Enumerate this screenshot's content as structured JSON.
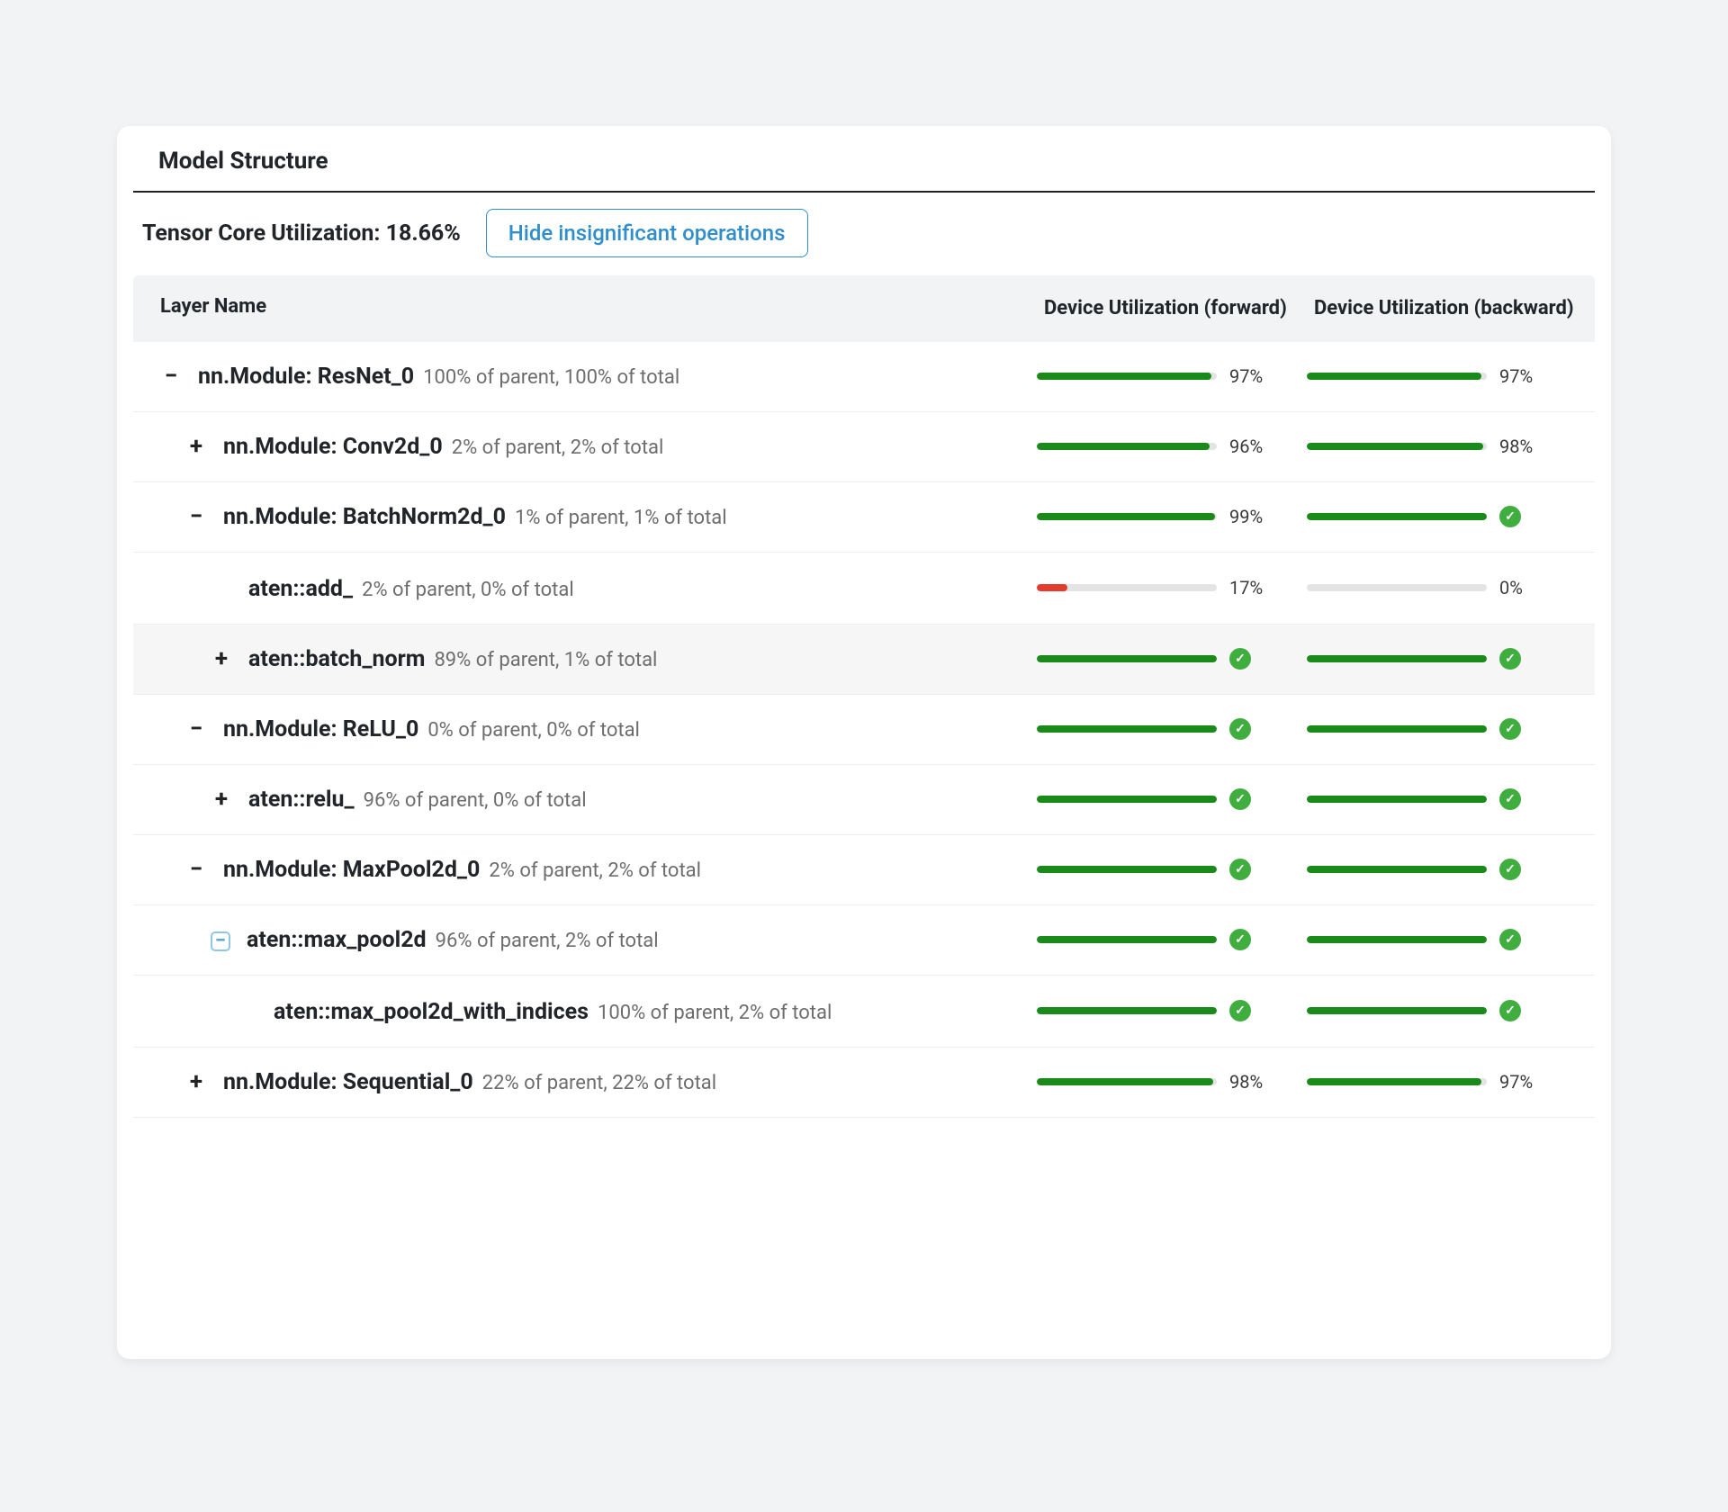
{
  "panel": {
    "title": "Model Structure",
    "tc_util_label": "Tensor Core Utilization: 18.66%",
    "hide_btn": "Hide insignificant operations"
  },
  "headers": {
    "layer": "Layer Name",
    "fwd": "Device Utilization (forward)",
    "bwd": "Device Utilization (backward)"
  },
  "rows": [
    {
      "indent": 0,
      "exp": "minus",
      "name": "nn.Module: ResNet_0",
      "sub": "100% of parent, 100% of total",
      "fwd": {
        "pct": 97,
        "label": "97%"
      },
      "bwd": {
        "pct": 97,
        "label": "97%"
      }
    },
    {
      "indent": 1,
      "exp": "plus",
      "name": "nn.Module: Conv2d_0",
      "sub": "2% of parent, 2% of total",
      "fwd": {
        "pct": 96,
        "label": "96%"
      },
      "bwd": {
        "pct": 98,
        "label": "98%"
      }
    },
    {
      "indent": 1,
      "exp": "minus",
      "name": "nn.Module: BatchNorm2d_0",
      "sub": "1% of parent, 1% of total",
      "fwd": {
        "pct": 99,
        "label": "99%"
      },
      "bwd": {
        "pct": 100,
        "check": true
      }
    },
    {
      "indent": 2,
      "exp": "none",
      "name": "aten::add_",
      "sub": "2% of parent, 0% of total",
      "fwd": {
        "pct": 17,
        "label": "17%",
        "red": true
      },
      "bwd": {
        "pct": 0,
        "label": "0%"
      }
    },
    {
      "indent": 2,
      "exp": "plus",
      "name": "aten::batch_norm",
      "sub": "89% of parent, 1% of total",
      "highlight": true,
      "fwd": {
        "pct": 100,
        "check": true
      },
      "bwd": {
        "pct": 100,
        "check": true
      }
    },
    {
      "indent": 1,
      "exp": "minus",
      "name": "nn.Module: ReLU_0",
      "sub": "0% of parent, 0% of total",
      "fwd": {
        "pct": 100,
        "check": true
      },
      "bwd": {
        "pct": 100,
        "check": true
      }
    },
    {
      "indent": 2,
      "exp": "plus",
      "name": "aten::relu_",
      "sub": "96% of parent, 0% of total",
      "fwd": {
        "pct": 100,
        "check": true
      },
      "bwd": {
        "pct": 100,
        "check": true
      }
    },
    {
      "indent": 1,
      "exp": "minus",
      "name": "nn.Module: MaxPool2d_0",
      "sub": "2% of parent, 2% of total",
      "fwd": {
        "pct": 100,
        "check": true
      },
      "bwd": {
        "pct": 100,
        "check": true
      }
    },
    {
      "indent": 2,
      "exp": "boxed-minus",
      "name": "aten::max_pool2d",
      "sub": "96% of parent, 2% of total",
      "fwd": {
        "pct": 100,
        "check": true
      },
      "bwd": {
        "pct": 100,
        "check": true
      }
    },
    {
      "indent": 3,
      "exp": "none",
      "name": "aten::max_pool2d_with_indices",
      "sub": "100% of parent, 2% of total",
      "fwd": {
        "pct": 100,
        "check": true
      },
      "bwd": {
        "pct": 100,
        "check": true
      }
    },
    {
      "indent": 1,
      "exp": "plus",
      "name": "nn.Module: Sequential_0",
      "sub": "22% of parent, 22% of total",
      "fwd": {
        "pct": 98,
        "label": "98%"
      },
      "bwd": {
        "pct": 97,
        "label": "97%"
      }
    }
  ]
}
